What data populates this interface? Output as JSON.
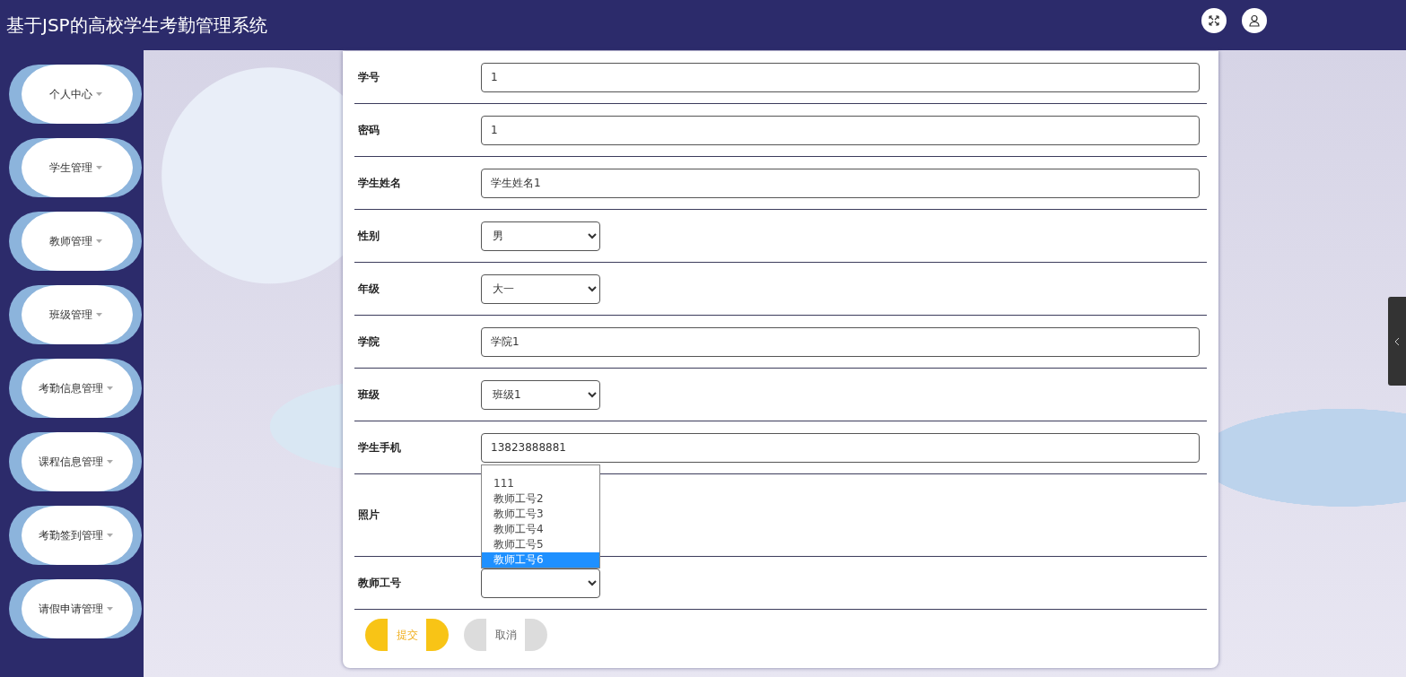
{
  "header": {
    "title": "基于JSP的高校学生考勤管理系统"
  },
  "sidebar": {
    "items": [
      {
        "label": "个人中心"
      },
      {
        "label": "学生管理"
      },
      {
        "label": "教师管理"
      },
      {
        "label": "班级管理"
      },
      {
        "label": "考勤信息管理"
      },
      {
        "label": "课程信息管理"
      },
      {
        "label": "考勤签到管理"
      },
      {
        "label": "请假申请管理"
      }
    ]
  },
  "form": {
    "fields": [
      {
        "label": "学号",
        "kind": "text",
        "value": "1"
      },
      {
        "label": "密码",
        "kind": "text",
        "value": "1"
      },
      {
        "label": "学生姓名",
        "kind": "text",
        "value": "学生姓名1"
      },
      {
        "label": "性别",
        "kind": "select",
        "value": "男"
      },
      {
        "label": "年级",
        "kind": "select",
        "value": "大一"
      },
      {
        "label": "学院",
        "kind": "text",
        "value": "学院1"
      },
      {
        "label": "班级",
        "kind": "select",
        "value": "班级1"
      },
      {
        "label": "学生手机",
        "kind": "text",
        "value": "13823888881"
      },
      {
        "label": "照片",
        "kind": "photo"
      },
      {
        "label": "教师工号",
        "kind": "select",
        "expanded": true,
        "options": [
          {
            "label": "111",
            "selected": false
          },
          {
            "label": "教师工号2",
            "selected": false
          },
          {
            "label": "教师工号3",
            "selected": false
          },
          {
            "label": "教师工号4",
            "selected": false
          },
          {
            "label": "教师工号5",
            "selected": false
          },
          {
            "label": "教师工号6",
            "selected": true
          }
        ]
      }
    ],
    "buttons": [
      {
        "label": "提交",
        "kind": "primary"
      },
      {
        "label": "取消",
        "kind": "secondary"
      }
    ]
  }
}
